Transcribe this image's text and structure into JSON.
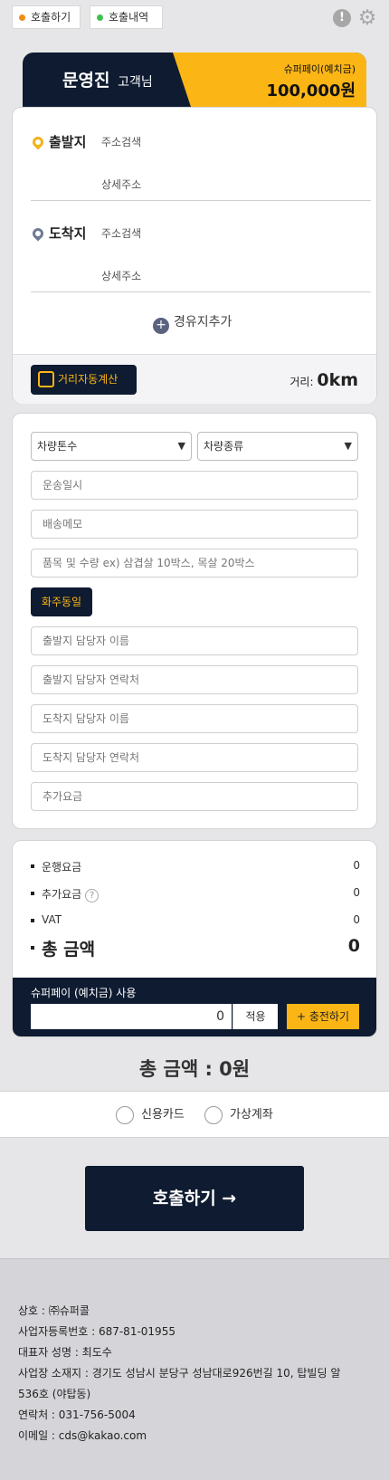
{
  "topbar": {
    "tab_call": "호출하기",
    "tab_history": "호출내역",
    "tab_call_dot": "#f28c14",
    "tab_history_dot": "#3cc24a",
    "alert_icon": "alert-icon",
    "gear_icon": "gear-icon"
  },
  "banner": {
    "customer_name": "문영진",
    "customer_suffix": "고객님",
    "pay_label": "슈퍼페이(예치금)",
    "pay_amount": "100,000원"
  },
  "address": {
    "origin": {
      "label": "출발지",
      "search_placeholder": "주소검색",
      "detail_placeholder": "상세주소",
      "pin_color": "#f3b31a"
    },
    "destination": {
      "label": "도착지",
      "search_placeholder": "주소검색",
      "detail_placeholder": "상세주소",
      "pin_color": "#6f7a93"
    },
    "add_waypoint": "경유지추가",
    "distance_button": "거리자동계산",
    "distance_label": "거리:",
    "distance_value": "0km"
  },
  "form": {
    "tonnage_select": "차량톤수",
    "vehicle_type_select": "차량종류",
    "transport_datetime": "운송일시",
    "delivery_memo": "배송메모",
    "items_placeholder": "품목 및 수량   ex) 삼겹살 10박스, 목살 20박스",
    "same_as_owner": "화주동일",
    "origin_contact_name": "출발지 담당자 이름",
    "origin_contact_phone": "출발지 담당자 연락처",
    "dest_contact_name": "도착지 담당자 이름",
    "dest_contact_phone": "도착지 담당자 연락처",
    "extra_fee": "추가요금"
  },
  "fare": {
    "items": [
      {
        "label": "운행요금",
        "value": "0"
      },
      {
        "label": "추가요금",
        "value": "0"
      },
      {
        "label": "VAT",
        "value": "0"
      }
    ],
    "total_label": "총 금액",
    "total_value": "0",
    "superpay_title": "슈퍼페이 (예치금) 사용",
    "superpay_input": "0",
    "apply_button": "적용",
    "charge_button": "충전하기"
  },
  "grand_total": "총 금액 : 0원",
  "payment_methods": [
    "신용카드",
    "가상계좌"
  ],
  "call_button": "호출하기 →",
  "footer": [
    "상호 : ㈜슈퍼콜",
    "사업자등록번호 : 687-81-01955",
    "대표자 성명 : 최도수",
    "사업장 소재지 : 경기도 성남시 분당구 성남대로926번길 10, 탑빌딩 알",
    "536호 (야탑동)",
    "연락처 : 031-756-5004",
    "이메일 : cds@kakao.com"
  ],
  "colors": {
    "navy": "#0e1b31",
    "yellow": "#fbb515"
  }
}
